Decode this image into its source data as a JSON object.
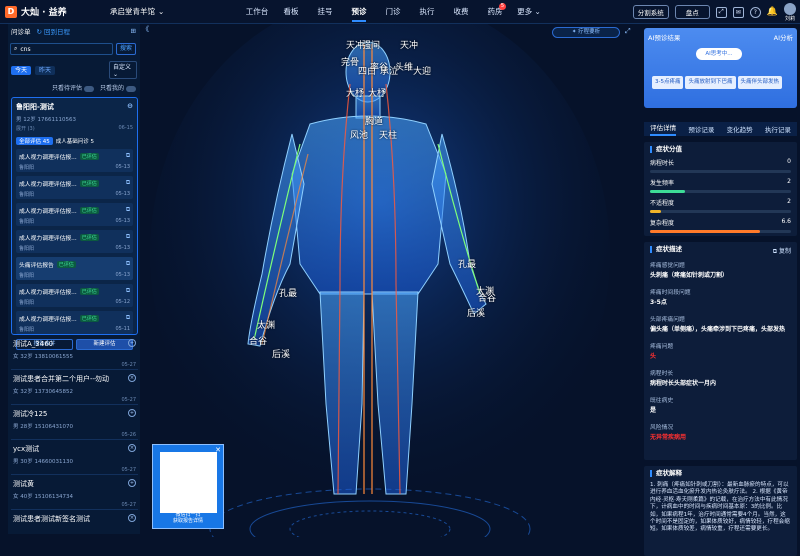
{
  "header": {
    "logo_mark": "D",
    "logo_text": "大灿 · 益养",
    "clinic": "承启堂青羊馆",
    "nav": [
      "工作台",
      "看板",
      "挂号",
      "预诊",
      "门诊",
      "执行",
      "收费",
      "药房",
      "更多"
    ],
    "nav_active": 3,
    "pharmacy_badge": "5",
    "split_system": "分割系统",
    "checkout": "盘点",
    "user": "刘莉"
  },
  "left": {
    "tab_active": "问诊单",
    "tab_other": "回到日程",
    "search_value": "cns",
    "search_button": "搜索",
    "filter_today": "今天",
    "filter_yesterday": "昨天",
    "filter_select": "自定义",
    "toggle_unread": "只看待评估",
    "toggle_mine": "只看我的",
    "patient": {
      "name": "鲁阳阳-测试",
      "gender_age": "男 12岁",
      "phone": "17661110563",
      "note": "展开 (3)",
      "date": "06-15",
      "cat_active": "全部评估 45",
      "cat_other": "成人基础问诊 5",
      "reports": [
        {
          "title": "成人视力调理评估报...",
          "tag": "已评估",
          "doctor": "鲁阳阳",
          "date": "05-13"
        },
        {
          "title": "成人视力调理评估报...",
          "tag": "已评估",
          "doctor": "鲁阳阳",
          "date": "05-13"
        },
        {
          "title": "成人视力调理评估报...",
          "tag": "已评估",
          "doctor": "鲁阳阳",
          "date": "05-13"
        },
        {
          "title": "成人视力调理评估报...",
          "tag": "已评估",
          "doctor": "鲁阳阳",
          "date": "05-13"
        },
        {
          "title": "头痛评估报告",
          "tag": "已评估",
          "doctor": "鲁阳阳",
          "date": "05-13"
        },
        {
          "title": "成人视力调理评估报...",
          "tag": "已评估",
          "doctor": "鲁阳阳",
          "date": "05-12"
        },
        {
          "title": "成人视力调理评估报...",
          "tag": "已评估",
          "doctor": "鲁阳阳",
          "date": "05-11"
        }
      ],
      "btn_merge": "报告合并",
      "btn_new": "新建评估"
    },
    "others": [
      {
        "name": "测试A_3460",
        "info": "女 32岁 13810061555",
        "date": "05-27"
      },
      {
        "name": "测试患者合并第二个用户--勿动",
        "info": "女 32岁 13730645852",
        "date": "05-27"
      },
      {
        "name": "测试冷125",
        "info": "男 28岁 15106431070",
        "date": "05-26"
      },
      {
        "name": "ycx测试",
        "info": "男 30岁 14660031130",
        "date": "05-27"
      },
      {
        "name": "测试黄",
        "info": "女 40岁 15106134734",
        "date": "05-27"
      },
      {
        "name": "测试患者测试新签名测试",
        "info": "",
        "date": ""
      }
    ]
  },
  "center": {
    "collapse_icon": "《",
    "ai_button": "疗程要析",
    "points": [
      "天冲",
      "天冲",
      "完骨",
      "四白",
      "头维",
      "承泣",
      "大迎",
      "大杼",
      "大杼",
      "胸道",
      "孔最",
      "孔最",
      "太渊",
      "太渊",
      "合谷",
      "合谷",
      "后溪",
      "后溪",
      "天柱",
      "风池",
      "强间",
      "率谷"
    ],
    "qr_text1": "微信扫一扫",
    "qr_text2": "获取报告详情"
  },
  "right": {
    "ai_title": "AI预诊结果",
    "ai_analysis": "AI分析",
    "ai_loading": "AI思考中...",
    "chips": [
      "3-5点疼痛",
      "头痛放射到下巴痛",
      "头痛伴头部发热"
    ],
    "tabs": [
      "评估详情",
      "预诊记录",
      "变化趋势",
      "执行记录"
    ],
    "symptom_section": "症状分值",
    "metrics": [
      {
        "label": "病程时长",
        "value": "0",
        "fraction": 0.0,
        "color": "#3ddc97"
      },
      {
        "label": "发生频率",
        "value": "2",
        "fraction": 0.25,
        "color": "#3ddc97"
      },
      {
        "label": "不适程度",
        "value": "2",
        "fraction": 0.08,
        "color": "#f0b429"
      },
      {
        "label": "复杂程度",
        "value": "6.6",
        "fraction": 0.78,
        "color": "#ff7a2a"
      }
    ],
    "desc_section": "症状描述",
    "copy": "复制",
    "fields": [
      {
        "label": "疼痛感觉问题",
        "value": "头刺痛（疼痛如针刺或刀割）",
        "red": false
      },
      {
        "label": "疼痛时间段问题",
        "value": "3-5点",
        "red": false
      },
      {
        "label": "头部疼痛问题",
        "value": "偏头痛（单侧痛），头痛牵涉到下巴疼痛，头部发热",
        "red": false
      },
      {
        "label": "疼痛问题",
        "value": "头",
        "red": true
      },
      {
        "label": "病程时长",
        "value": "病程时长头部症状一月内",
        "red": false
      },
      {
        "label": "既往病史",
        "value": "是",
        "red": false
      },
      {
        "label": "风险情况",
        "value": "无异常疾病用",
        "red": true
      }
    ],
    "explain_section": "症状解释",
    "explain": "1. 刺痛（疼痛如针刺或刀割）：最新血脉瘀的特点，可以进行养血活血化瘀升发内热论灸肤疗法。 2. 根据《黄帝内经·灵枢·寿夭刚柔篇》的记载，在治疗方法中有此情况下，计病血中的时间与疾病时间基本原：3的比例。比如，如果病程1年，治疗时间通常需要4个月。当然，这个时间不是固定的，如果体质较好，病情较轻，疗程会缩短。如果体质较差，病情较重，疗程还需要更长。"
  }
}
